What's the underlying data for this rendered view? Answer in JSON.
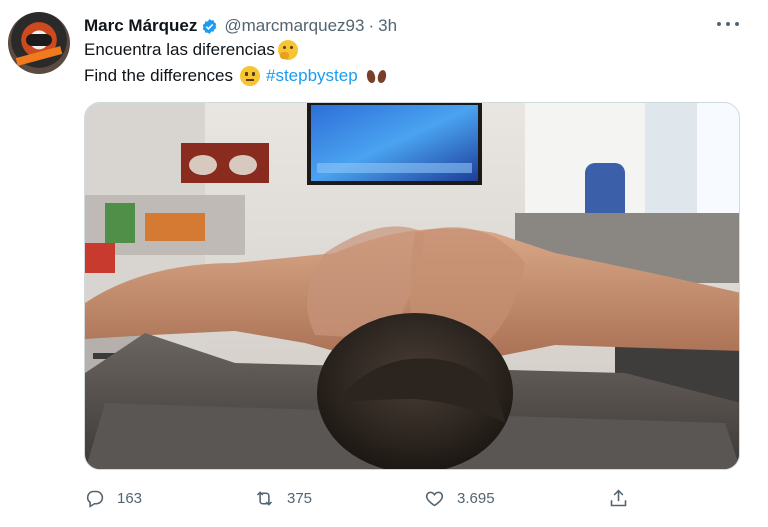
{
  "tweet": {
    "author": {
      "name": "Marc Márquez",
      "handle": "@marcmarquez93",
      "separator": "·",
      "time": "3h",
      "avatar_icon": "rider-helmet-avatar",
      "verified_icon": "verified-badge-icon"
    },
    "text": {
      "line1": "Encuentra las diferencias",
      "line1_emoji": "thinking-face-emoji",
      "line2": "Find the differences",
      "line2_emoji": "neutral-face-emoji",
      "hashtag": "#stepbystep",
      "line2_trailing_emoji": "footprints-emoji"
    },
    "actions": {
      "reply_count": "163",
      "retweet_count": "375",
      "like_count": "3.695"
    }
  },
  "colors": {
    "accent": "#1d9bf0",
    "text_primary": "#0f1419",
    "text_secondary": "#536471",
    "border": "#cfd9de"
  }
}
